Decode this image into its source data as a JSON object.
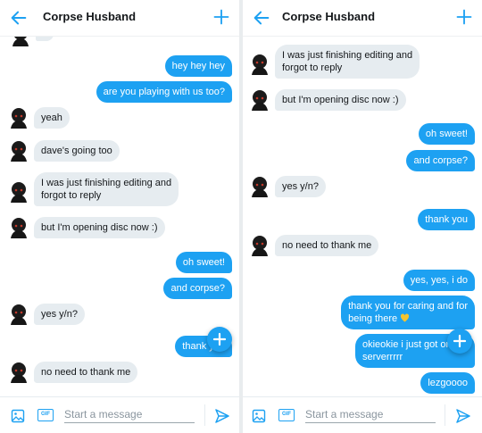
{
  "colors": {
    "accent": "#1da1f2",
    "incoming_bubble": "#e6ecf0",
    "incoming_text": "#14171a",
    "outgoing_text": "#ffffff"
  },
  "left": {
    "header": {
      "title": "Corpse Husband"
    },
    "messages": [
      {
        "side": "out",
        "text": "hey hey hey"
      },
      {
        "side": "out",
        "text": "are you playing with us too?"
      },
      {
        "side": "in",
        "text": "yeah"
      },
      {
        "side": "in",
        "text": "dave's going too"
      },
      {
        "side": "in",
        "line1": "I was just finishing editing and",
        "line2": "forgot to reply"
      },
      {
        "side": "in",
        "text": "but I'm opening disc now :)"
      },
      {
        "side": "out",
        "text": "oh sweet!"
      },
      {
        "side": "out",
        "text": "and corpse?"
      },
      {
        "side": "in",
        "text": "yes y/n?"
      },
      {
        "side": "out",
        "text": "thank you"
      },
      {
        "side": "in",
        "text": "no need to thank me"
      }
    ],
    "composer": {
      "placeholder": "Start a message",
      "gif_label": "GIF"
    }
  },
  "right": {
    "header": {
      "title": "Corpse Husband"
    },
    "messages": [
      {
        "side": "in",
        "line1": "I was just finishing editing and",
        "line2": "forgot to reply"
      },
      {
        "side": "in",
        "text": "but I'm opening disc now :)"
      },
      {
        "side": "out",
        "text": "oh sweet!"
      },
      {
        "side": "out",
        "text": "and corpse?"
      },
      {
        "side": "in",
        "text": "yes y/n?"
      },
      {
        "side": "out",
        "text": "thank you"
      },
      {
        "side": "in",
        "text": "no need to thank me"
      },
      {
        "side": "out",
        "text": "yes, yes, i do"
      },
      {
        "side": "out",
        "line1": "thank you for caring and for",
        "line2": "being there",
        "emoji": "yellow-heart"
      },
      {
        "side": "out",
        "line1": "okieokie i just got on the",
        "line2": "serverrrrr"
      },
      {
        "side": "out",
        "text": "lezgoooo"
      }
    ],
    "composer": {
      "placeholder": "Start a message",
      "gif_label": "GIF"
    }
  }
}
